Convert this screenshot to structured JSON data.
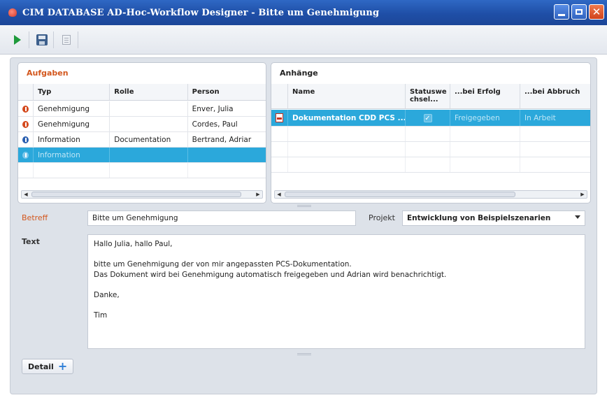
{
  "window": {
    "title": "CIM DATABASE AD-Hoc-Workflow Designer - Bitte um Genehmigung"
  },
  "toolbar": {
    "buttons": [
      {
        "icon": "play-icon"
      },
      {
        "icon": "save-icon"
      },
      {
        "icon": "document-icon"
      }
    ]
  },
  "tasks": {
    "title": "Aufgaben",
    "columns": [
      "Typ",
      "Rolle",
      "Person"
    ],
    "rows": [
      {
        "status": "warning",
        "typ": "Genehmigung",
        "rolle": "",
        "person": "Enver, Julia"
      },
      {
        "status": "warning",
        "typ": "Genehmigung",
        "rolle": "",
        "person": "Cordes, Paul"
      },
      {
        "status": "info",
        "typ": "Information",
        "rolle": "Documentation",
        "person": "Bertrand, Adriar"
      },
      {
        "status": "info",
        "typ": "Information",
        "rolle": "",
        "person": ""
      }
    ]
  },
  "attachments": {
    "title": "Anhänge",
    "columns": [
      "Name",
      "Statuswe chsel...",
      "...bei Erfolg",
      "...bei Abbruch"
    ],
    "rows": [
      {
        "name": "Dokumentation CDD PCS ...",
        "status_change": true,
        "on_success": "Freigegeben",
        "on_abort": "In Arbeit"
      }
    ]
  },
  "form": {
    "subject_label": "Betreff",
    "subject_value": "Bitte um Genehmigung",
    "project_label": "Projekt",
    "project_value": "Entwicklung von Beispielszenarien",
    "text_label": "Text",
    "text_lines": [
      "Hallo Julia, hallo Paul,",
      "bitte um Genehmigung der von mir angepassten PCS-Dokumentation.",
      "Das Dokument wird bei Genehmigung automatisch freigegeben und Adrian wird benachrichtigt.",
      "Danke,",
      "Tim"
    ]
  },
  "detail_button": {
    "label": "Detail"
  },
  "colors": {
    "title_bar": "#1f4fa7",
    "selection": "#2ba8db",
    "section_title": "#d3571d"
  }
}
